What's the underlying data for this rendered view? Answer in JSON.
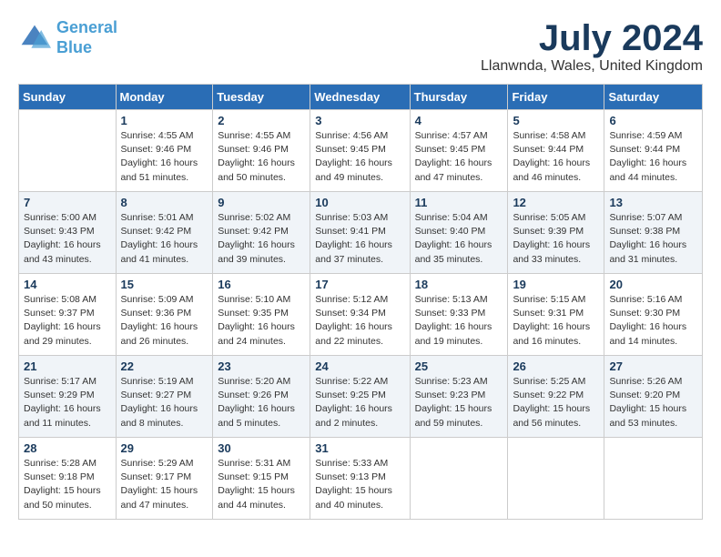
{
  "logo": {
    "line1": "General",
    "line2": "Blue"
  },
  "title": "July 2024",
  "location": "Llanwnda, Wales, United Kingdom",
  "days_header": [
    "Sunday",
    "Monday",
    "Tuesday",
    "Wednesday",
    "Thursday",
    "Friday",
    "Saturday"
  ],
  "weeks": [
    [
      {
        "day": "",
        "info": ""
      },
      {
        "day": "1",
        "info": "Sunrise: 4:55 AM\nSunset: 9:46 PM\nDaylight: 16 hours\nand 51 minutes."
      },
      {
        "day": "2",
        "info": "Sunrise: 4:55 AM\nSunset: 9:46 PM\nDaylight: 16 hours\nand 50 minutes."
      },
      {
        "day": "3",
        "info": "Sunrise: 4:56 AM\nSunset: 9:45 PM\nDaylight: 16 hours\nand 49 minutes."
      },
      {
        "day": "4",
        "info": "Sunrise: 4:57 AM\nSunset: 9:45 PM\nDaylight: 16 hours\nand 47 minutes."
      },
      {
        "day": "5",
        "info": "Sunrise: 4:58 AM\nSunset: 9:44 PM\nDaylight: 16 hours\nand 46 minutes."
      },
      {
        "day": "6",
        "info": "Sunrise: 4:59 AM\nSunset: 9:44 PM\nDaylight: 16 hours\nand 44 minutes."
      }
    ],
    [
      {
        "day": "7",
        "info": "Sunrise: 5:00 AM\nSunset: 9:43 PM\nDaylight: 16 hours\nand 43 minutes."
      },
      {
        "day": "8",
        "info": "Sunrise: 5:01 AM\nSunset: 9:42 PM\nDaylight: 16 hours\nand 41 minutes."
      },
      {
        "day": "9",
        "info": "Sunrise: 5:02 AM\nSunset: 9:42 PM\nDaylight: 16 hours\nand 39 minutes."
      },
      {
        "day": "10",
        "info": "Sunrise: 5:03 AM\nSunset: 9:41 PM\nDaylight: 16 hours\nand 37 minutes."
      },
      {
        "day": "11",
        "info": "Sunrise: 5:04 AM\nSunset: 9:40 PM\nDaylight: 16 hours\nand 35 minutes."
      },
      {
        "day": "12",
        "info": "Sunrise: 5:05 AM\nSunset: 9:39 PM\nDaylight: 16 hours\nand 33 minutes."
      },
      {
        "day": "13",
        "info": "Sunrise: 5:07 AM\nSunset: 9:38 PM\nDaylight: 16 hours\nand 31 minutes."
      }
    ],
    [
      {
        "day": "14",
        "info": "Sunrise: 5:08 AM\nSunset: 9:37 PM\nDaylight: 16 hours\nand 29 minutes."
      },
      {
        "day": "15",
        "info": "Sunrise: 5:09 AM\nSunset: 9:36 PM\nDaylight: 16 hours\nand 26 minutes."
      },
      {
        "day": "16",
        "info": "Sunrise: 5:10 AM\nSunset: 9:35 PM\nDaylight: 16 hours\nand 24 minutes."
      },
      {
        "day": "17",
        "info": "Sunrise: 5:12 AM\nSunset: 9:34 PM\nDaylight: 16 hours\nand 22 minutes."
      },
      {
        "day": "18",
        "info": "Sunrise: 5:13 AM\nSunset: 9:33 PM\nDaylight: 16 hours\nand 19 minutes."
      },
      {
        "day": "19",
        "info": "Sunrise: 5:15 AM\nSunset: 9:31 PM\nDaylight: 16 hours\nand 16 minutes."
      },
      {
        "day": "20",
        "info": "Sunrise: 5:16 AM\nSunset: 9:30 PM\nDaylight: 16 hours\nand 14 minutes."
      }
    ],
    [
      {
        "day": "21",
        "info": "Sunrise: 5:17 AM\nSunset: 9:29 PM\nDaylight: 16 hours\nand 11 minutes."
      },
      {
        "day": "22",
        "info": "Sunrise: 5:19 AM\nSunset: 9:27 PM\nDaylight: 16 hours\nand 8 minutes."
      },
      {
        "day": "23",
        "info": "Sunrise: 5:20 AM\nSunset: 9:26 PM\nDaylight: 16 hours\nand 5 minutes."
      },
      {
        "day": "24",
        "info": "Sunrise: 5:22 AM\nSunset: 9:25 PM\nDaylight: 16 hours\nand 2 minutes."
      },
      {
        "day": "25",
        "info": "Sunrise: 5:23 AM\nSunset: 9:23 PM\nDaylight: 15 hours\nand 59 minutes."
      },
      {
        "day": "26",
        "info": "Sunrise: 5:25 AM\nSunset: 9:22 PM\nDaylight: 15 hours\nand 56 minutes."
      },
      {
        "day": "27",
        "info": "Sunrise: 5:26 AM\nSunset: 9:20 PM\nDaylight: 15 hours\nand 53 minutes."
      }
    ],
    [
      {
        "day": "28",
        "info": "Sunrise: 5:28 AM\nSunset: 9:18 PM\nDaylight: 15 hours\nand 50 minutes."
      },
      {
        "day": "29",
        "info": "Sunrise: 5:29 AM\nSunset: 9:17 PM\nDaylight: 15 hours\nand 47 minutes."
      },
      {
        "day": "30",
        "info": "Sunrise: 5:31 AM\nSunset: 9:15 PM\nDaylight: 15 hours\nand 44 minutes."
      },
      {
        "day": "31",
        "info": "Sunrise: 5:33 AM\nSunset: 9:13 PM\nDaylight: 15 hours\nand 40 minutes."
      },
      {
        "day": "",
        "info": ""
      },
      {
        "day": "",
        "info": ""
      },
      {
        "day": "",
        "info": ""
      }
    ]
  ]
}
